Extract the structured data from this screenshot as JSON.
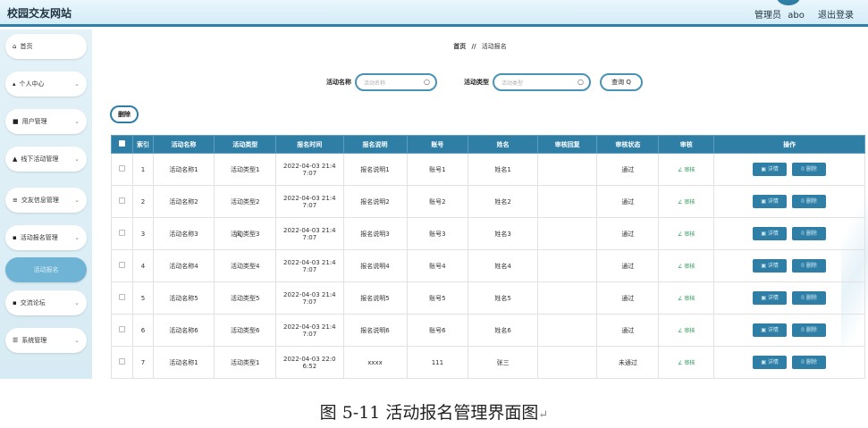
{
  "header": {
    "site_title": "校园交友网站",
    "role": "管理员",
    "user": "abo",
    "logout": "退出登录"
  },
  "sidebar": {
    "items": [
      {
        "label": "首页",
        "icon": "home-icon",
        "glyph": "⌂",
        "chevron": false
      },
      {
        "label": "个人中心",
        "icon": "user-icon",
        "glyph": "▴",
        "chevron": true
      },
      {
        "label": "用户管理",
        "icon": "users-icon",
        "glyph": "■",
        "chevron": true
      },
      {
        "label": "线下活动管理",
        "icon": "event-icon",
        "glyph": "▲",
        "chevron": true
      },
      {
        "label": "交友信息管理",
        "icon": "list-icon",
        "glyph": "≡",
        "chevron": true
      },
      {
        "label": "活动报名管理",
        "icon": "grid-icon",
        "glyph": "▪",
        "chevron": true
      },
      {
        "label": "活动报名",
        "icon": "",
        "glyph": "",
        "chevron": false,
        "sub": true
      },
      {
        "label": "交流论坛",
        "icon": "grid-icon",
        "glyph": "▪",
        "chevron": true
      },
      {
        "label": "系统管理",
        "icon": "settings-icon",
        "glyph": "☰",
        "chevron": true
      }
    ],
    "chevron_glyph": "⌄"
  },
  "breadcrumb": {
    "home": "首页",
    "sep": "//",
    "current": "活动报名"
  },
  "search": {
    "name_label": "活动名称",
    "name_placeholder": "活动名称",
    "type_label": "活动类型",
    "type_placeholder": "活动类型",
    "query_button": "查询 Q",
    "search_glyph": "○"
  },
  "toolbar": {
    "delete_label": "删除"
  },
  "table": {
    "headers": [
      "",
      "索引",
      "活动名称",
      "活动类型",
      "报名时间",
      "报名说明",
      "账号",
      "姓名",
      "审核回复",
      "审核状态",
      "审核",
      "操作"
    ],
    "audit_label": "∠ 审核",
    "detail_label": "▣ 详情",
    "delete_label": "⌷ 删除",
    "rows": [
      {
        "index": "1",
        "name": "活动名称1",
        "type": "活动类型1",
        "time": [
          "2022-04-03 21:4",
          "7:07"
        ],
        "note": "报名说明1",
        "account": "账号1",
        "person": "姓名1",
        "reply": "",
        "status": "通过"
      },
      {
        "index": "2",
        "name": "活动名称2",
        "type": "活动类型2",
        "time": [
          "2022-04-03 21:4",
          "7:07"
        ],
        "note": "报名说明2",
        "account": "账号2",
        "person": "姓名2",
        "reply": "",
        "status": "通过"
      },
      {
        "index": "3",
        "name": "活动名称3",
        "type": "活动类型3",
        "time": [
          "2022-04-03 21:4",
          "7:07"
        ],
        "note": "报名说明3",
        "account": "账号3",
        "person": "姓名3",
        "reply": "",
        "status": "通过"
      },
      {
        "index": "4",
        "name": "活动名称4",
        "type": "活动类型4",
        "time": [
          "2022-04-03 21:4",
          "7:07"
        ],
        "note": "报名说明4",
        "account": "账号4",
        "person": "姓名4",
        "reply": "",
        "status": "通过"
      },
      {
        "index": "5",
        "name": "活动名称5",
        "type": "活动类型5",
        "time": [
          "2022-04-03 21:4",
          "7:07"
        ],
        "note": "报名说明5",
        "account": "账号5",
        "person": "姓名5",
        "reply": "",
        "status": "通过"
      },
      {
        "index": "6",
        "name": "活动名称6",
        "type": "活动类型6",
        "time": [
          "2022-04-03 21:4",
          "7:07"
        ],
        "note": "报名说明6",
        "account": "账号6",
        "person": "姓名6",
        "reply": "",
        "status": "通过"
      },
      {
        "index": "7",
        "name": "活动名称1",
        "type": "活动类型1",
        "time": [
          "2022-04-03 22:0",
          "6:52"
        ],
        "note": "xxxx",
        "account": "111",
        "person": "张三",
        "reply": "",
        "status": "未通过"
      }
    ]
  },
  "caption": {
    "text": "图 5-11 活动报名管理界面图",
    "mark": "↵"
  },
  "colors": {
    "accent": "#2e7ea6",
    "sidebar_bg": "#d7ebf4",
    "active_sub": "#6fb3d5",
    "audit": "#2e9a58"
  }
}
